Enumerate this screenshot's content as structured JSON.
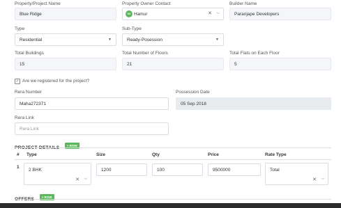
{
  "property": {
    "name_label": "Property/Project Name",
    "name_value": "Blue Ridge",
    "owner_label": "Property Owner Contact",
    "owner_value": "Hamur",
    "owner_avatar": "HA",
    "builder_label": "Builder Name",
    "builder_value": "Paranjape Developers"
  },
  "type": {
    "type_label": "Type",
    "type_value": "Residential",
    "subtype_label": "Sub-Type",
    "subtype_value": "Ready-Posession"
  },
  "counts": {
    "buildings_label": "Total Buildings",
    "buildings_value": "15",
    "floors_label": "Total Number of Floors",
    "floors_value": "21",
    "flats_label": "Total Flats on Each Floor",
    "flats_value": "5"
  },
  "rera": {
    "registered_label": "Are we registered for the project?",
    "registered_checked": true,
    "number_label": "Rera Number",
    "number_value": "Maha272371",
    "possession_label": "Possession Date",
    "possession_value": "05 Sep 2018",
    "link_label": "Rera Link",
    "link_placeholder": "Rera Link"
  },
  "project_details": {
    "title": "PROJECT DETAILS",
    "add_row_label": "+ ROW",
    "columns": [
      "#",
      "Type",
      "Size",
      "Qty",
      "Price",
      "Rate Type"
    ],
    "rows": [
      {
        "index": "1",
        "type": "2 BHK",
        "size": "1200",
        "qty": "100",
        "price": "9500000",
        "rate_type": "Total"
      }
    ]
  },
  "offers": {
    "title": "OFFERS",
    "add_row_label": "+ ROW"
  },
  "colors": {
    "accent_green": "#5cb85c"
  }
}
